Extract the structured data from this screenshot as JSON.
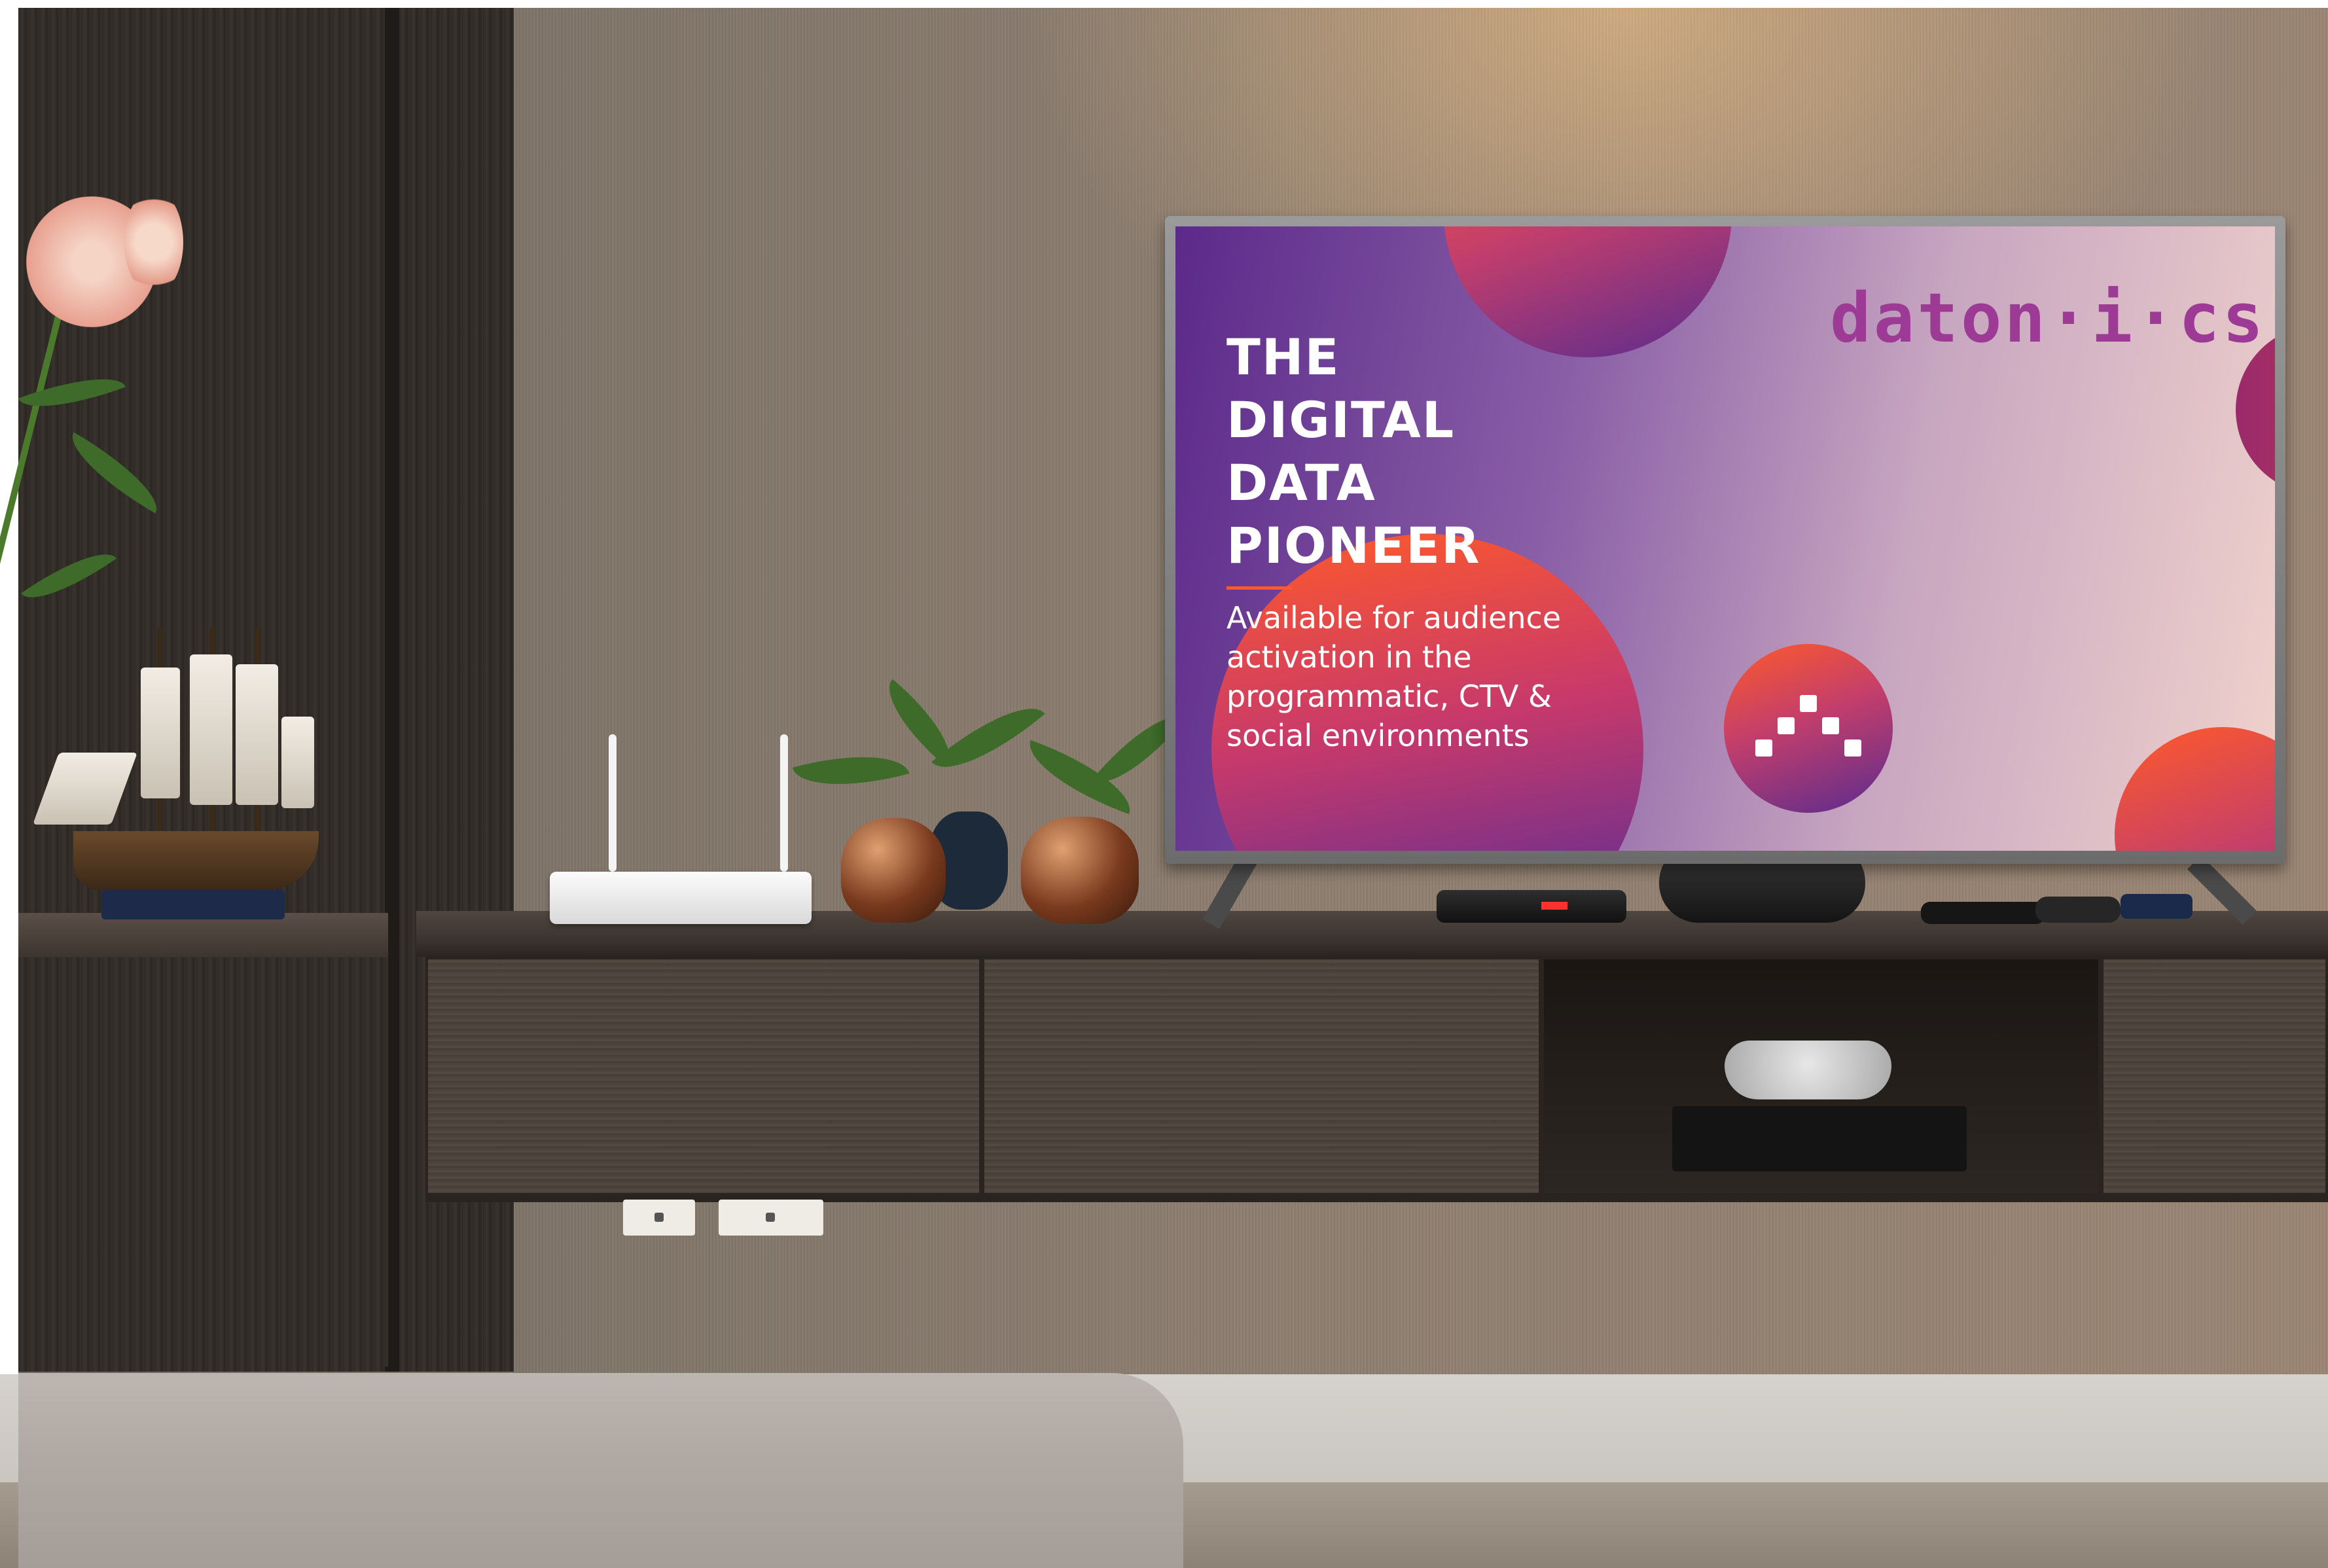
{
  "tv_screen": {
    "headline": [
      "THE",
      "DIGITAL",
      "DATA",
      "PIONEER"
    ],
    "subtext": [
      "Available for audience",
      "activation in the",
      "programmatic,  CTV &",
      "social environments"
    ],
    "brand_logo": "daton·i·cs",
    "colors": {
      "accent": "#ff5a2a",
      "purple": "#5b2a8a",
      "magenta": "#c23e6c",
      "logo": "#9c3a96"
    }
  },
  "icons": {
    "logo_mark": "dots-triangle-icon"
  }
}
